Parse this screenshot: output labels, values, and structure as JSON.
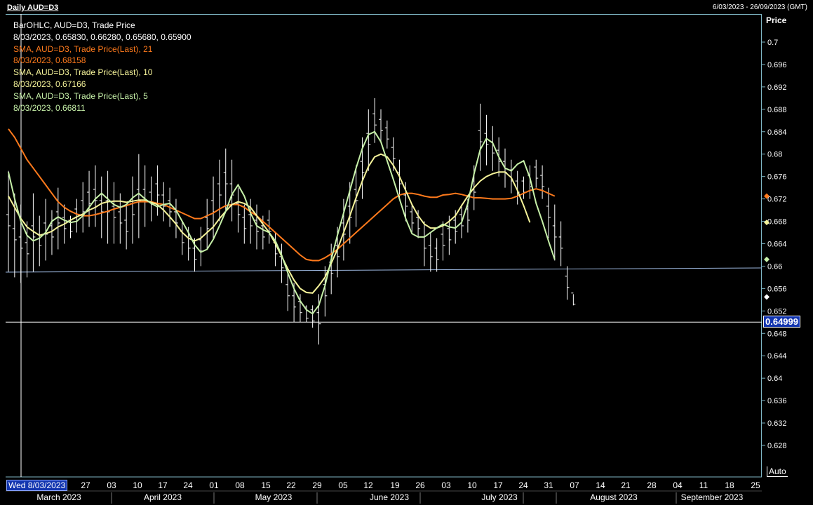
{
  "header": {
    "title": "Daily AUD=D3",
    "date_range": "6/03/2023 - 26/09/2023 (GMT)"
  },
  "legend": [
    {
      "text": "BarOHLC, AUD=D3, Trade Price",
      "color": "#ffffff"
    },
    {
      "text": "8/03/2023, 0.65830, 0.66280, 0.65680, 0.65900",
      "color": "#ffffff"
    },
    {
      "text": "SMA, AUD=D3, Trade Price(Last),  21",
      "color": "#ff7a1c"
    },
    {
      "text": "8/03/2023, 0.68158",
      "color": "#ff7a1c"
    },
    {
      "text": "SMA, AUD=D3, Trade Price(Last),  10",
      "color": "#f6f49a"
    },
    {
      "text": "8/03/2023, 0.67166",
      "color": "#f6f49a"
    },
    {
      "text": "SMA, AUD=D3, Trade Price(Last),  5",
      "color": "#c6f0a8"
    },
    {
      "text": "8/03/2023, 0.66811",
      "color": "#c6f0a8"
    }
  ],
  "axis": {
    "price_label": "Price",
    "auto_label": "Auto",
    "cursor_date": "Wed 8/03/2023",
    "current_price": "0.64999"
  },
  "chart_data": {
    "type": "line",
    "title": "Daily AUD=D3",
    "ylabel": "Price",
    "ylim": [
      0.625,
      0.703
    ],
    "y_ticks": [
      "0.7",
      "0.696",
      "0.692",
      "0.688",
      "0.684",
      "0.68",
      "0.676",
      "0.672",
      "0.668",
      "0.664",
      "0.66",
      "0.656",
      "0.652",
      "0.648",
      "0.644",
      "0.64",
      "0.636",
      "0.632",
      "0.628"
    ],
    "x_tick_labels": [
      "27",
      "03",
      "10",
      "17",
      "24",
      "01",
      "08",
      "15",
      "22",
      "29",
      "05",
      "12",
      "19",
      "26",
      "03",
      "10",
      "17",
      "24",
      "31",
      "07",
      "14",
      "21",
      "28",
      "04",
      "11",
      "18",
      "25"
    ],
    "months": [
      "March 2023",
      "April 2023",
      "May 2023",
      "June 2023",
      "July 2023",
      "August 2023",
      "September 2023"
    ],
    "horizontal_lines": [
      0.65,
      0.6587
    ],
    "colors": {
      "bars": "#ffffff",
      "sma21": "#ff7a1c",
      "sma10": "#f6f49a",
      "sma5": "#c6f0a8",
      "hline": "#9db8e0"
    },
    "bars_hl": [
      [
        0.677,
        0.659
      ],
      [
        0.673,
        0.658
      ],
      [
        0.671,
        0.657
      ],
      [
        0.668,
        0.658
      ],
      [
        0.673,
        0.659
      ],
      [
        0.669,
        0.66
      ],
      [
        0.672,
        0.661
      ],
      [
        0.67,
        0.662
      ],
      [
        0.674,
        0.663
      ],
      [
        0.671,
        0.664
      ],
      [
        0.669,
        0.665
      ],
      [
        0.672,
        0.666
      ],
      [
        0.675,
        0.666
      ],
      [
        0.677,
        0.667
      ],
      [
        0.678,
        0.667
      ],
      [
        0.676,
        0.665
      ],
      [
        0.677,
        0.664
      ],
      [
        0.675,
        0.664
      ],
      [
        0.673,
        0.664
      ],
      [
        0.671,
        0.663
      ],
      [
        0.676,
        0.664
      ],
      [
        0.68,
        0.665
      ],
      [
        0.678,
        0.667
      ],
      [
        0.676,
        0.668
      ],
      [
        0.678,
        0.669
      ],
      [
        0.675,
        0.668
      ],
      [
        0.674,
        0.667
      ],
      [
        0.672,
        0.665
      ],
      [
        0.668,
        0.662
      ],
      [
        0.667,
        0.661
      ],
      [
        0.665,
        0.659
      ],
      [
        0.667,
        0.66
      ],
      [
        0.672,
        0.663
      ],
      [
        0.676,
        0.665
      ],
      [
        0.679,
        0.668
      ],
      [
        0.681,
        0.67
      ],
      [
        0.679,
        0.668
      ],
      [
        0.674,
        0.666
      ],
      [
        0.671,
        0.664
      ],
      [
        0.672,
        0.664
      ],
      [
        0.671,
        0.663
      ],
      [
        0.669,
        0.663
      ],
      [
        0.67,
        0.664
      ],
      [
        0.666,
        0.66
      ],
      [
        0.664,
        0.657
      ],
      [
        0.659,
        0.652
      ],
      [
        0.657,
        0.65
      ],
      [
        0.655,
        0.65
      ],
      [
        0.653,
        0.65
      ],
      [
        0.653,
        0.649
      ],
      [
        0.655,
        0.646
      ],
      [
        0.66,
        0.651
      ],
      [
        0.664,
        0.655
      ],
      [
        0.667,
        0.658
      ],
      [
        0.672,
        0.661
      ],
      [
        0.675,
        0.664
      ],
      [
        0.678,
        0.667
      ],
      [
        0.683,
        0.672
      ],
      [
        0.688,
        0.677
      ],
      [
        0.69,
        0.682
      ],
      [
        0.688,
        0.682
      ],
      [
        0.686,
        0.681
      ],
      [
        0.683,
        0.677
      ],
      [
        0.679,
        0.672
      ],
      [
        0.675,
        0.668
      ],
      [
        0.671,
        0.666
      ],
      [
        0.67,
        0.665
      ],
      [
        0.668,
        0.66
      ],
      [
        0.666,
        0.659
      ],
      [
        0.665,
        0.659
      ],
      [
        0.668,
        0.661
      ],
      [
        0.669,
        0.662
      ],
      [
        0.67,
        0.664
      ],
      [
        0.671,
        0.665
      ],
      [
        0.672,
        0.666
      ],
      [
        0.678,
        0.67
      ],
      [
        0.689,
        0.677
      ],
      [
        0.687,
        0.678
      ],
      [
        0.685,
        0.677
      ],
      [
        0.683,
        0.676
      ],
      [
        0.681,
        0.674
      ],
      [
        0.679,
        0.673
      ],
      [
        0.677,
        0.671
      ],
      [
        0.676,
        0.672
      ],
      [
        0.678,
        0.672
      ],
      [
        0.679,
        0.674
      ],
      [
        0.678,
        0.672
      ],
      [
        0.674,
        0.665
      ],
      [
        0.671,
        0.661
      ],
      [
        0.668,
        0.66
      ],
      [
        0.66,
        0.654
      ],
      [
        0.655,
        0.653
      ]
    ],
    "sma21": [
      0.6845,
      0.683,
      0.681,
      0.679,
      0.6775,
      0.676,
      0.6745,
      0.673,
      0.6715,
      0.6705,
      0.6698,
      0.6693,
      0.669,
      0.669,
      0.6692,
      0.6695,
      0.6698,
      0.6702,
      0.6705,
      0.6708,
      0.6712,
      0.6715,
      0.6715,
      0.6715,
      0.6712,
      0.671,
      0.6705,
      0.67,
      0.6695,
      0.669,
      0.6685,
      0.6685,
      0.669,
      0.6695,
      0.6702,
      0.6708,
      0.671,
      0.671,
      0.6705,
      0.6697,
      0.669,
      0.668,
      0.667,
      0.666,
      0.665,
      0.664,
      0.663,
      0.662,
      0.6612,
      0.661,
      0.661,
      0.6615,
      0.6622,
      0.663,
      0.664,
      0.665,
      0.666,
      0.667,
      0.668,
      0.669,
      0.67,
      0.671,
      0.672,
      0.6727,
      0.673,
      0.673,
      0.6728,
      0.6725,
      0.6723,
      0.6723,
      0.6727,
      0.6728,
      0.673,
      0.6728,
      0.6725,
      0.6722,
      0.6722,
      0.6721,
      0.672,
      0.672,
      0.672,
      0.6721,
      0.6725,
      0.673,
      0.6735,
      0.6738,
      0.6735,
      0.673,
      0.6725
    ],
    "sma10": [
      0.6725,
      0.6705,
      0.6685,
      0.667,
      0.6662,
      0.6655,
      0.6658,
      0.6662,
      0.667,
      0.6675,
      0.6682,
      0.6688,
      0.6693,
      0.67,
      0.6705,
      0.6712,
      0.6715,
      0.6716,
      0.6716,
      0.6714,
      0.6716,
      0.6718,
      0.6718,
      0.6714,
      0.671,
      0.67,
      0.6688,
      0.6675,
      0.666,
      0.665,
      0.6645,
      0.665,
      0.666,
      0.667,
      0.6685,
      0.6698,
      0.671,
      0.6715,
      0.6712,
      0.6705,
      0.669,
      0.6675,
      0.666,
      0.664,
      0.6618,
      0.6595,
      0.6575,
      0.656,
      0.6553,
      0.6552,
      0.6565,
      0.658,
      0.6605,
      0.663,
      0.666,
      0.669,
      0.6722,
      0.6752,
      0.6778,
      0.6795,
      0.68,
      0.6795,
      0.678,
      0.676,
      0.6735,
      0.671,
      0.669,
      0.6675,
      0.6668,
      0.6668,
      0.6672,
      0.668,
      0.669,
      0.6708,
      0.6725,
      0.674,
      0.6752,
      0.676,
      0.6765,
      0.6768,
      0.6768,
      0.6758,
      0.6735,
      0.6708,
      0.6678
    ],
    "sma5": [
      0.6768,
      0.672,
      0.668,
      0.6655,
      0.6645,
      0.665,
      0.666,
      0.668,
      0.6688,
      0.6682,
      0.6678,
      0.668,
      0.669,
      0.6705,
      0.672,
      0.673,
      0.672,
      0.671,
      0.6705,
      0.671,
      0.6722,
      0.673,
      0.672,
      0.6712,
      0.6706,
      0.671,
      0.6712,
      0.67,
      0.668,
      0.666,
      0.6638,
      0.6625,
      0.663,
      0.6648,
      0.6672,
      0.6698,
      0.6728,
      0.6745,
      0.6725,
      0.6695,
      0.6672,
      0.6665,
      0.666,
      0.6645,
      0.662,
      0.6588,
      0.656,
      0.6538,
      0.6522,
      0.6515,
      0.653,
      0.6565,
      0.6612,
      0.6655,
      0.6695,
      0.6735,
      0.6775,
      0.681,
      0.6835,
      0.684,
      0.6822,
      0.6788,
      0.6755,
      0.672,
      0.6685,
      0.6658,
      0.6652,
      0.6652,
      0.666,
      0.6668,
      0.6675,
      0.667,
      0.6668,
      0.6678,
      0.6712,
      0.6765,
      0.6808,
      0.6828,
      0.682,
      0.6795,
      0.6775,
      0.677,
      0.6782,
      0.6788,
      0.6758,
      0.6712,
      0.668,
      0.6645,
      0.6612
    ]
  }
}
